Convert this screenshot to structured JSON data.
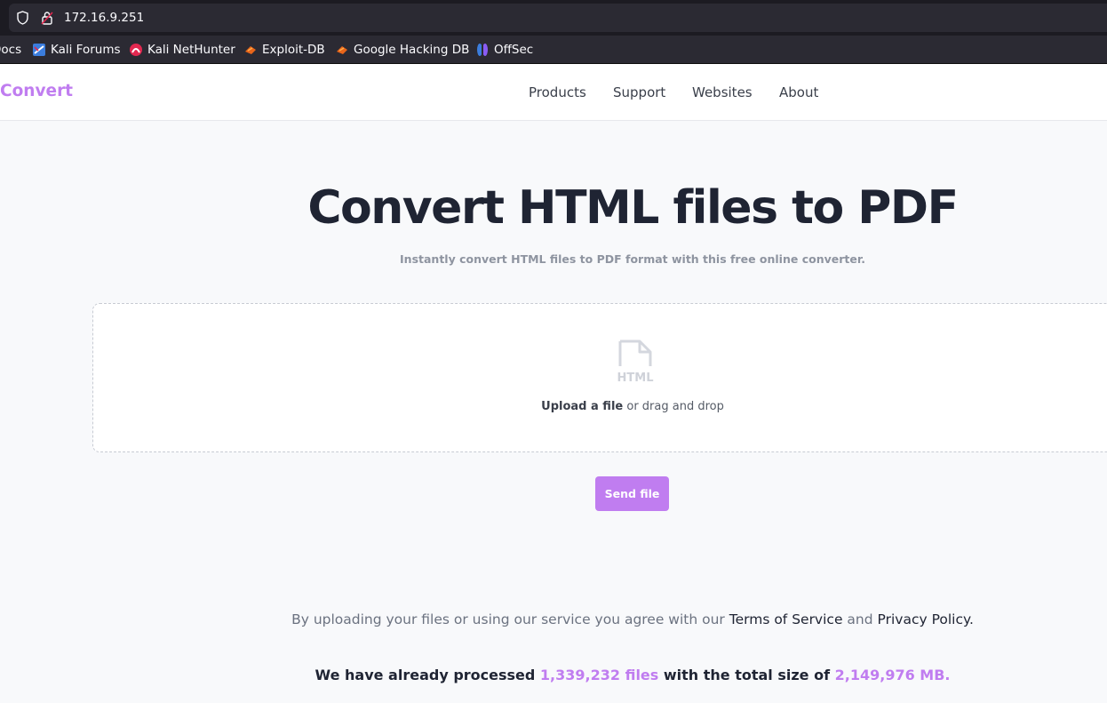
{
  "browser": {
    "url": "172.16.9.251",
    "bookmarks": [
      {
        "label": "Docs",
        "icon": "docs-icon"
      },
      {
        "label": "Kali Forums",
        "icon": "kali-forums-icon"
      },
      {
        "label": "Kali NetHunter",
        "icon": "kali-nethunter-icon"
      },
      {
        "label": "Exploit-DB",
        "icon": "exploit-db-icon"
      },
      {
        "label": "Google Hacking DB",
        "icon": "google-hacking-db-icon"
      },
      {
        "label": "OffSec",
        "icon": "offsec-icon"
      }
    ]
  },
  "site": {
    "logo": "Convert",
    "nav": [
      "Products",
      "Support",
      "Websites",
      "About"
    ],
    "accent_color": "#c07df0"
  },
  "hero": {
    "title": "Convert HTML files to PDF",
    "subtitle": "Instantly convert HTML files to PDF format with this free online converter."
  },
  "upload": {
    "icon_label": "HTML",
    "link_text": "Upload a file",
    "rest_text": "or drag and drop",
    "button_label": "Send file"
  },
  "footer": {
    "terms_prefix": "By uploading your files or using our service you agree with our",
    "terms_link": "Terms of Service",
    "and_text": "and",
    "privacy_link": "Privacy Policy.",
    "stats_prefix": "We have already processed",
    "files_count": "1,339,232 files",
    "stats_middle": "with the total size of",
    "total_size": "2,149,976 MB."
  }
}
